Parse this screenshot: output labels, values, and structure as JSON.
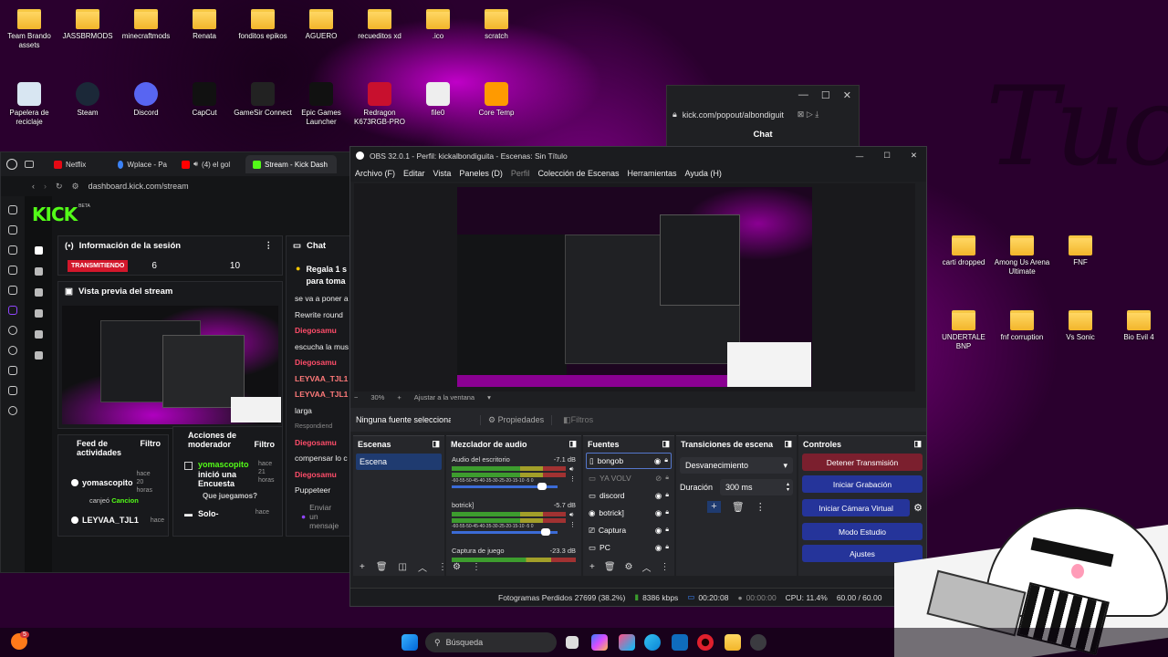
{
  "desktop": {
    "icons_row1": [
      "Team Brando assets",
      "JASSBRMODS",
      "minecraftmods",
      "Renata",
      "fonditos epikos",
      "AGUERO",
      "recueditos xd",
      ".ico",
      "scratch"
    ],
    "icons_row2": [
      "Papelera de reciclaje",
      "Steam",
      "Discord",
      "CapCut",
      "GameSir Connect",
      "Epic Games Launcher",
      "Redragon K673RGB-PRO",
      "file0",
      "Core Temp"
    ],
    "icons_right1": [
      "carti dropped",
      "Among Us Arena Ultimate",
      "FNF"
    ],
    "icons_right2": [
      "UNDERTALE BNP",
      "fnf corruption",
      "Vs Sonic",
      "Bio Evil 4"
    ],
    "art_text": "Tuo"
  },
  "popout": {
    "url": "kick.com/popout/albondiguit",
    "title": "Chat"
  },
  "browser": {
    "tabs": [
      "Netflix",
      "Wplace - Pa",
      "(4) el gol",
      "Stream - Kick Dash"
    ],
    "url": "dashboard.kick.com/stream",
    "logo": "KICK",
    "logo_badge": "BETA",
    "session_title": "Información de la sesión",
    "live_badge": "TRANSMITIENDO",
    "stat1": "6",
    "stat2": "10",
    "preview_title": "Vista previa del stream",
    "feed_title": "Feed de actividades",
    "feed_filter": "Filtro",
    "feed_items": [
      {
        "user": "yomascopito",
        "time": "hace 20 horas",
        "text": "canjeó",
        "extra": "Cancion"
      },
      {
        "user": "LEYVAA_TJL1",
        "time": "hace",
        "text": "",
        "extra": ""
      }
    ],
    "mod_title": "Acciones de moderador",
    "mod_filter": "Filtro",
    "mod_items": [
      {
        "user": "yomascopito",
        "action": "inició una Encuesta",
        "time": "hace 21 horas",
        "detail": "Que juegamos?"
      },
      {
        "user": "Solo-",
        "action": "",
        "time": "hace",
        "detail": ""
      }
    ],
    "chat_title": "Chat",
    "chat_pinned": "Regala 1 s para toma",
    "chat_lines": [
      "se va a poner a",
      "Rewrite round",
      "Diegosamu",
      "escucha la mus",
      "Diegosamu",
      "LEYVAA_TJL1",
      "LEYVAA_TJL1",
      "larga",
      "Respondiend",
      "Diegosamu",
      "compensar lo c",
      "Diegosamu",
      "Puppeteer"
    ],
    "chat_input": "Enviar un mensaje"
  },
  "obs": {
    "title": "OBS 32.0.1 - Perfil: kickalbondiguita - Escenas: Sin Título",
    "menu": [
      "Archivo (F)",
      "Editar",
      "Vista",
      "Paneles (D)",
      "Perfil",
      "Colección de Escenas",
      "Herramientas",
      "Ayuda (H)"
    ],
    "zoom": "30%",
    "fit": "Ajustar a la ventana",
    "no_source": "Ninguna fuente seleccionad",
    "props": "Propiedades",
    "filters": "Filtros",
    "scenes_title": "Escenas",
    "scenes": [
      "Escena"
    ],
    "mixer_title": "Mezclador de audio",
    "mixer": [
      {
        "name": "Audio del escritorio",
        "db": "-7.1 dB"
      },
      {
        "name": "botrick]",
        "db": "-5.7 dB"
      },
      {
        "name": "Captura de juego",
        "db": "-23.3 dB"
      }
    ],
    "mixer_scale": "-60-55-50-45-40-35-30-25-20-15-10 -5 0",
    "sources_title": "Fuentes",
    "sources": [
      "bongob",
      "YA VOLV",
      "discord",
      "botrick]",
      "Captura",
      "PC"
    ],
    "transitions_title": "Transiciones de escena",
    "transition": "Desvanecimiento",
    "duration_label": "Duración",
    "duration": "300 ms",
    "controls_title": "Controles",
    "controls": [
      "Detener Transmisión",
      "Iniciar Grabación",
      "Iniciar Cámara Virtual",
      "Modo Estudio",
      "Ajustes"
    ],
    "status": {
      "frames": "Fotogramas Perdidos 27699 (38.2%)",
      "kbps": "8386 kbps",
      "live": "00:20:08",
      "rec": "00:00:00",
      "cpu": "CPU: 11.4%",
      "fps": "60.00 / 60.00"
    }
  },
  "taskbar": {
    "search": "Búsqueda",
    "badge": "5"
  },
  "colors": {
    "kick_green": "#53fc18",
    "obs_red": "#7b1f2e",
    "obs_blue": "#25349a"
  }
}
